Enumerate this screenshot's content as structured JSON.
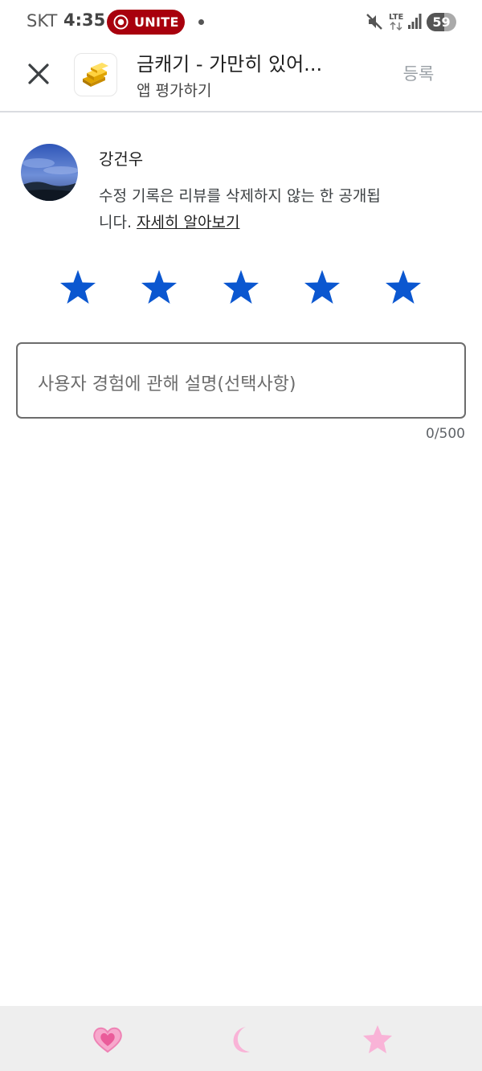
{
  "status_bar": {
    "carrier": "SKT",
    "time": "4:35",
    "unite_label": "UNITE",
    "battery_level": 59,
    "battery_text": "59",
    "network": "LTE"
  },
  "app_bar": {
    "app_title": "금캐기 - 가만히 있어...",
    "subtitle": "앱 평가하기",
    "submit_label": "등록"
  },
  "user": {
    "name": "강건우",
    "notice_text": "수정 기록은 리뷰를 삭제하지 않는 한 공개됩니다.",
    "learn_more": "자세히 알아보기"
  },
  "rating": {
    "value": 5,
    "max": 5,
    "star_color": "#0b57d0"
  },
  "review": {
    "placeholder": "사용자 경험에 관해 설명(선택사항)",
    "char_count": "0/500"
  },
  "colors": {
    "unite_pill": "#a8000d",
    "accent": "#0b57d0",
    "nav_icon": "#f9a8cf"
  },
  "bottom_nav": {
    "icons": [
      "heart-icon",
      "moon-icon",
      "star-icon"
    ]
  }
}
